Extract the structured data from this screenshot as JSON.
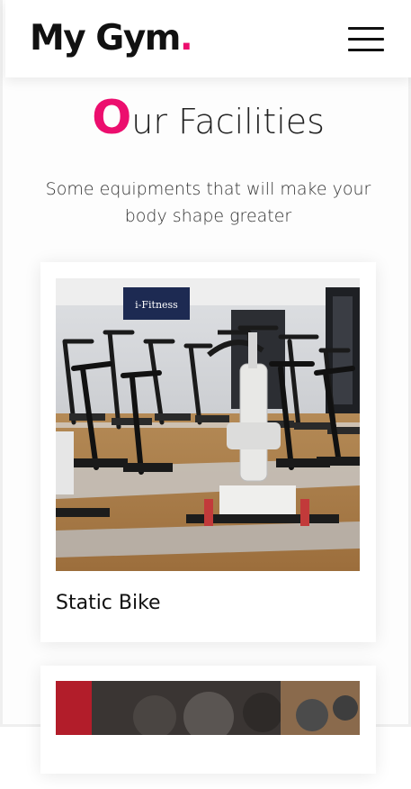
{
  "header": {
    "logo_text": "My Gym",
    "logo_dot": ".",
    "menu_icon": "hamburger-menu-icon"
  },
  "facilities": {
    "title_first_letter": "O",
    "title_rest": "ur Facilities",
    "subtitle": "Some equipments that will make your body shape greater",
    "cards": [
      {
        "label": "Static Bike",
        "sign_text": "i-Fitness"
      },
      {
        "label": ""
      }
    ]
  },
  "colors": {
    "accent": "#ec0e6e",
    "text": "#111111"
  }
}
